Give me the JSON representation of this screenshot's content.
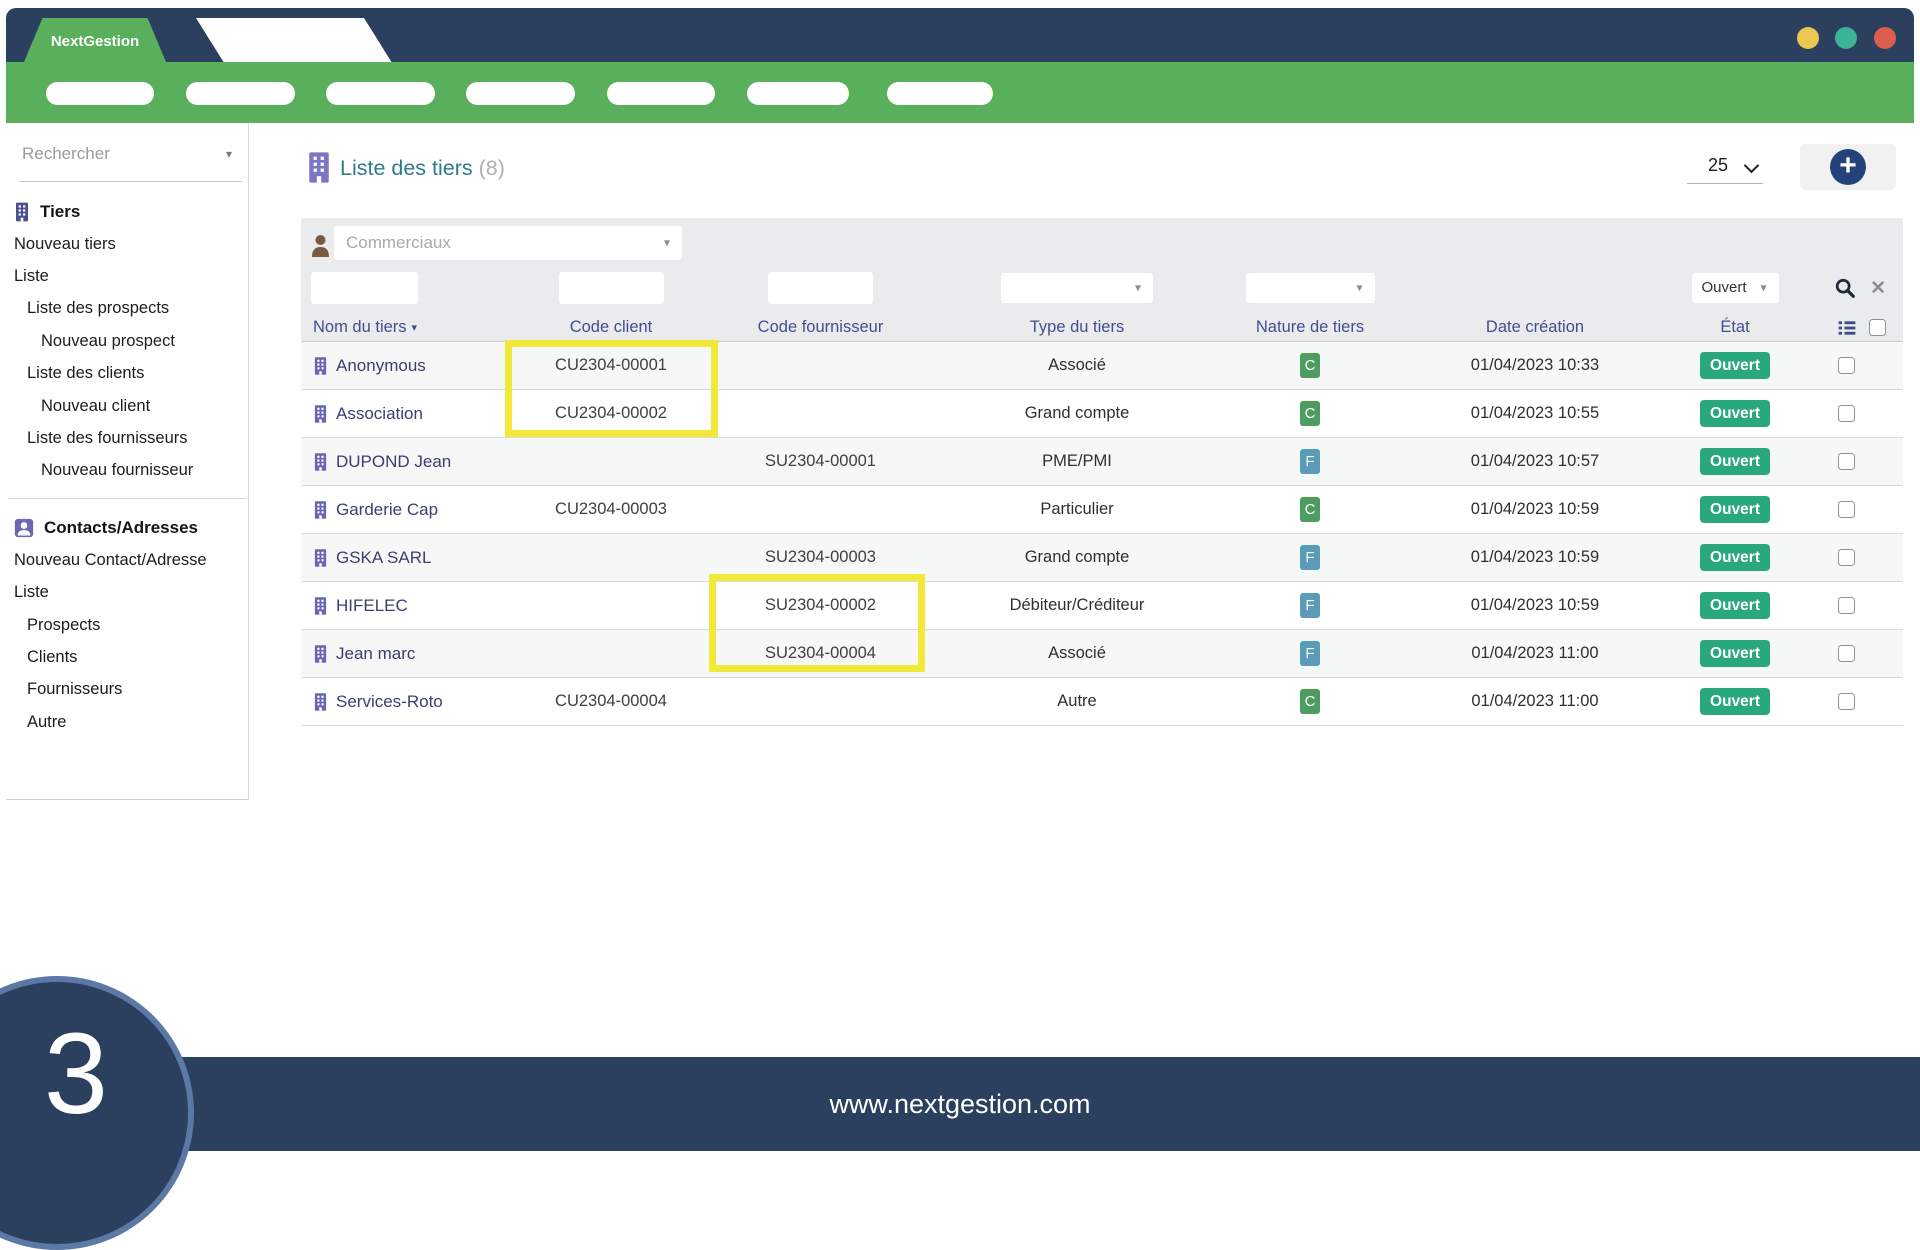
{
  "brand": "NextGestion",
  "window_controls": {
    "yellow": "#eec751",
    "teal": "#3cb396",
    "red": "#dc5f4e"
  },
  "nav": {
    "placeholder_item_count": 7
  },
  "sidebar": {
    "search_placeholder": "Rechercher",
    "sections": [
      {
        "title": "Tiers",
        "icon": "building-icon",
        "items": [
          {
            "label": "Nouveau tiers",
            "level": 0
          },
          {
            "label": "Liste",
            "level": 0
          },
          {
            "label": "Liste des prospects",
            "level": 1
          },
          {
            "label": "Nouveau prospect",
            "level": 2
          },
          {
            "label": "Liste des clients",
            "level": 1
          },
          {
            "label": "Nouveau client",
            "level": 2
          },
          {
            "label": "Liste des fournisseurs",
            "level": 1
          },
          {
            "label": "Nouveau fournisseur",
            "level": 2
          }
        ]
      },
      {
        "title": "Contacts/Adresses",
        "icon": "contact-icon",
        "items": [
          {
            "label": "Nouveau Contact/Adresse",
            "level": 0
          },
          {
            "label": "Liste",
            "level": 0
          },
          {
            "label": "Prospects",
            "level": 1
          },
          {
            "label": "Clients",
            "level": 1
          },
          {
            "label": "Fournisseurs",
            "level": 1
          },
          {
            "label": "Autre",
            "level": 1
          }
        ]
      }
    ]
  },
  "header": {
    "title": "Liste des tiers",
    "count": "(8)"
  },
  "toolbar": {
    "page_size": "25",
    "add_label": "+"
  },
  "filters": {
    "commercial_placeholder": "Commerciaux",
    "state_value": "Ouvert"
  },
  "table": {
    "columns": [
      {
        "label": "Nom du tiers",
        "sort": true
      },
      {
        "label": "Code client"
      },
      {
        "label": "Code fournisseur"
      },
      {
        "label": "Type du tiers"
      },
      {
        "label": "Nature de tiers"
      },
      {
        "label": "Date création"
      },
      {
        "label": "État"
      }
    ],
    "rows": [
      {
        "name": "Anonymous",
        "code_client": "CU2304-00001",
        "code_fournisseur": "",
        "type": "Associé",
        "nature": "C",
        "date": "01/04/2023 10:33",
        "etat": "Ouvert"
      },
      {
        "name": "Association",
        "code_client": "CU2304-00002",
        "code_fournisseur": "",
        "type": "Grand compte",
        "nature": "C",
        "date": "01/04/2023 10:55",
        "etat": "Ouvert"
      },
      {
        "name": "DUPOND Jean",
        "code_client": "",
        "code_fournisseur": "SU2304-00001",
        "type": "PME/PMI",
        "nature": "F",
        "date": "01/04/2023 10:57",
        "etat": "Ouvert"
      },
      {
        "name": "Garderie Cap",
        "code_client": "CU2304-00003",
        "code_fournisseur": "",
        "type": "Particulier",
        "nature": "C",
        "date": "01/04/2023 10:59",
        "etat": "Ouvert"
      },
      {
        "name": "GSKA SARL",
        "code_client": "",
        "code_fournisseur": "SU2304-00003",
        "type": "Grand compte",
        "nature": "F",
        "date": "01/04/2023 10:59",
        "etat": "Ouvert"
      },
      {
        "name": "HIFELEC",
        "code_client": "",
        "code_fournisseur": "SU2304-00002",
        "type": "Débiteur/Créditeur",
        "nature": "F",
        "date": "01/04/2023 10:59",
        "etat": "Ouvert"
      },
      {
        "name": "Jean marc",
        "code_client": "",
        "code_fournisseur": "SU2304-00004",
        "type": "Associé",
        "nature": "F",
        "date": "01/04/2023 11:00",
        "etat": "Ouvert"
      },
      {
        "name": "Services-Roto",
        "code_client": "CU2304-00004",
        "code_fournisseur": "",
        "type": "Autre",
        "nature": "C",
        "date": "01/04/2023 11:00",
        "etat": "Ouvert"
      }
    ]
  },
  "highlights": [
    {
      "target": "code-client rows 1-2",
      "color": "#f2e838"
    },
    {
      "target": "code-fournisseur rows 6-7",
      "color": "#f2e838"
    }
  ],
  "footer": {
    "url": "www.nextgestion.com",
    "step": "3"
  },
  "colors": {
    "navy": "#2b3f5e",
    "green": "#5aaf5c",
    "state_badge": "#2aa87d",
    "nature_client": "#4e9d60",
    "nature_fournisseur": "#5a9bb8",
    "column_header": "#434e8d",
    "title": "#2d7b8b",
    "highlight": "#f2e838"
  }
}
